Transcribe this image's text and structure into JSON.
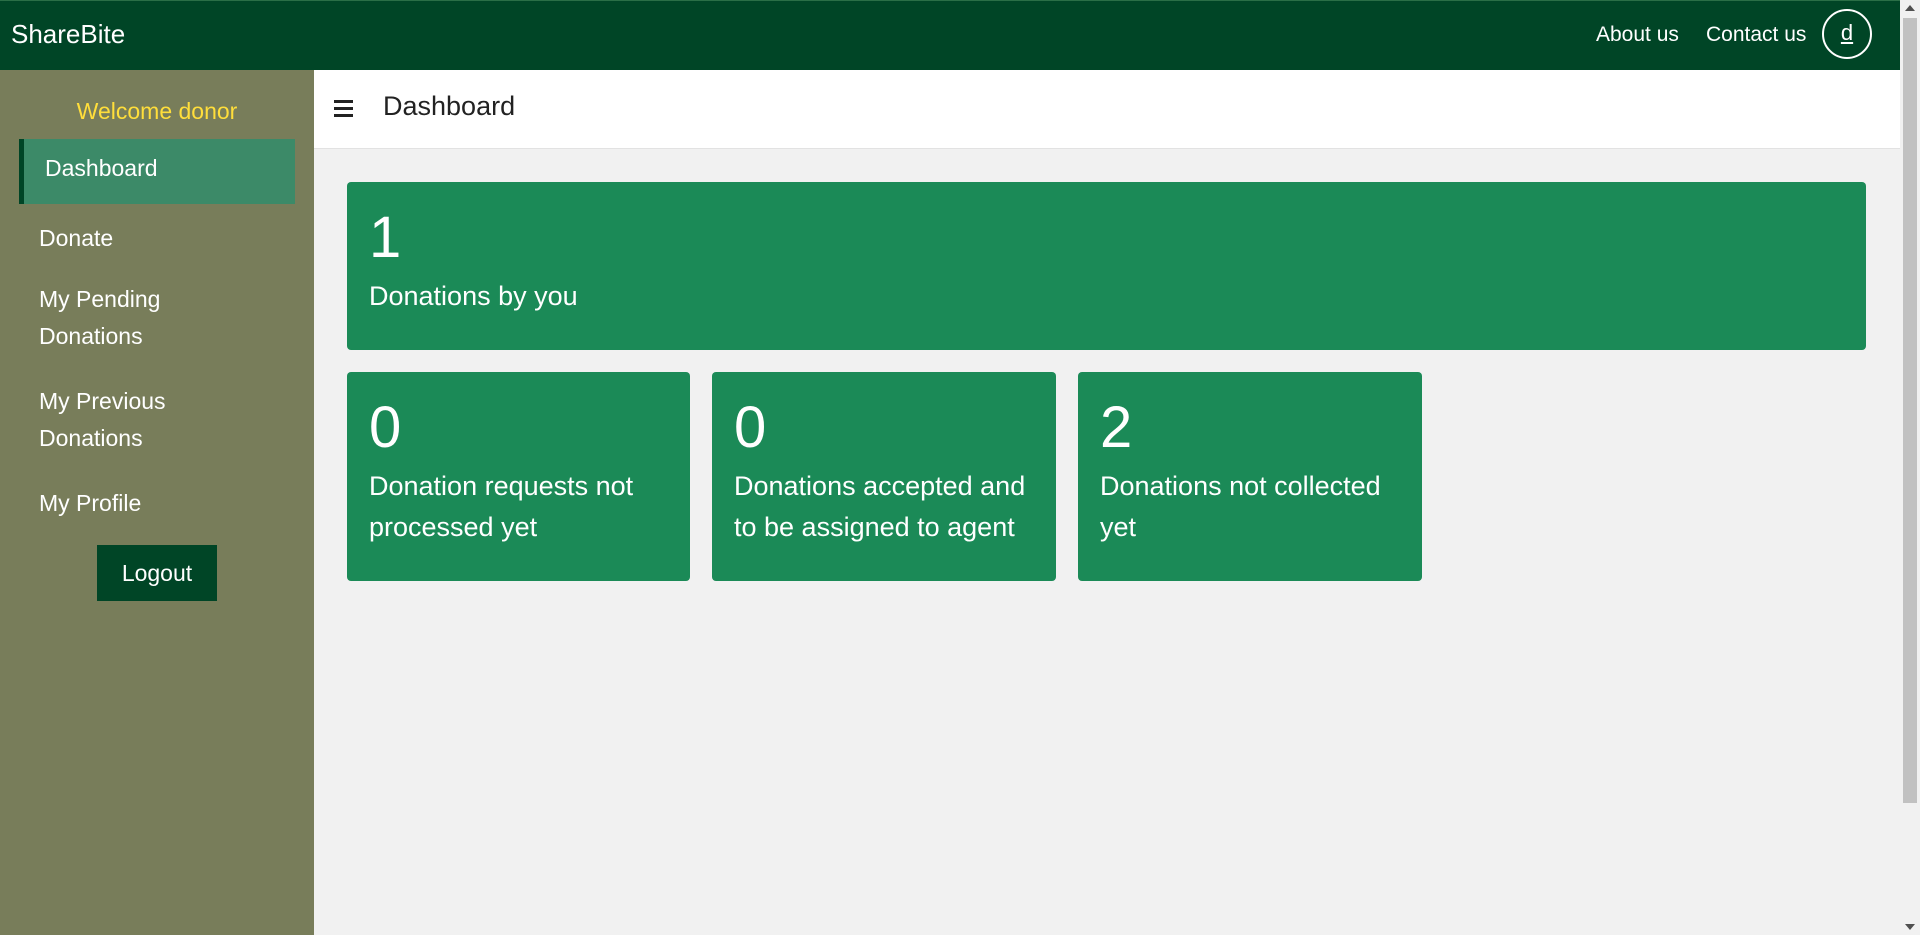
{
  "topbar": {
    "brand": "ShareBite",
    "links": {
      "about": "About us",
      "contact": "Contact us"
    },
    "avatar_initial": "d"
  },
  "sidebar": {
    "welcome": "Welcome donor",
    "items": {
      "dashboard": "Dashboard",
      "donate": "Donate",
      "pending_line1": "My Pending",
      "pending_line2": "Donations",
      "previous_line1": "My Previous",
      "previous_line2": "Donations",
      "profile": "My Profile"
    },
    "logout": "Logout"
  },
  "header": {
    "title": "Dashboard",
    "menu_icon": "hamburger-menu-icon"
  },
  "cards": {
    "total": {
      "value": "1",
      "label": "Donations by you"
    },
    "not_processed": {
      "value": "0",
      "line1": "Donation requests not",
      "line2": "processed yet"
    },
    "accepted": {
      "value": "0",
      "line1": "Donations accepted and",
      "line2": "to be assigned to agent"
    },
    "not_collected": {
      "value": "2",
      "line1": "Donations not collected",
      "line2": "yet"
    }
  },
  "colors": {
    "topbar": "#004526",
    "sidebar": "#787d5a",
    "welcome": "#ffde3b",
    "active_item": "#3c8a68",
    "card": "#1b8a57",
    "background": "#f1f1f1"
  }
}
